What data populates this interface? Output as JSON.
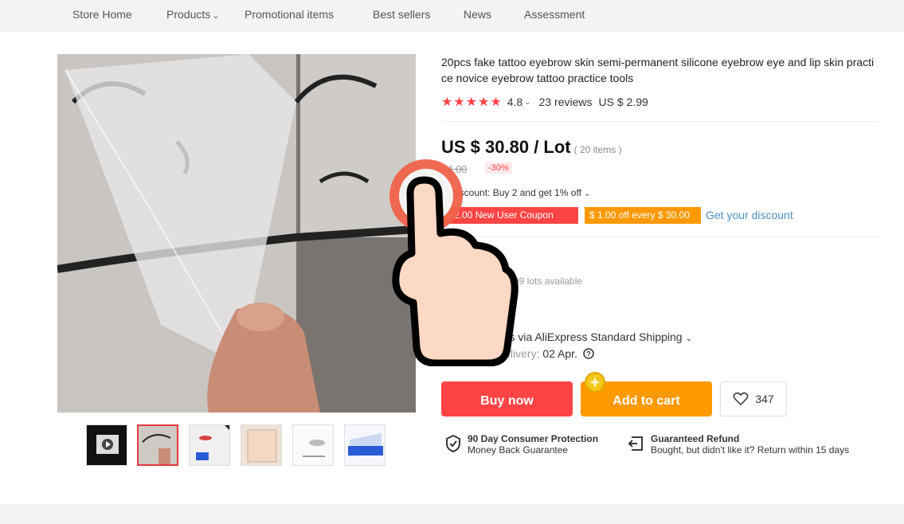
{
  "nav": {
    "items": [
      "Store Home",
      "Products",
      "Promotional items",
      "Best sellers",
      "News",
      "Assessment"
    ]
  },
  "product": {
    "title": "20pcs fake tattoo eyebrow skin semi-permanent silicone eyebrow eye and lip skin practice novice eyebrow tattoo practice tools",
    "rating": "4.8",
    "reviews": "23 reviews",
    "ref_price": "US $ 2.99",
    "price": "US $ 30.80 / Lot",
    "unit_note": "( 20 items )",
    "original_price": "44.00",
    "discount_badge": "-30%",
    "store_discount": "nt discount: Buy 2 and get 1% off",
    "coupon_red": "$ 2.00 New User Coupon",
    "coupon_orange": "$ 1.00 off every $ 30.00",
    "get_discount": "Get your discount",
    "availability": "99 lots available",
    "shipping_title": "g",
    "shipping_line": "ates via AliExpress Standard Shipping",
    "delivery_label": "Delivery:",
    "delivery_date": "02 Apr.",
    "buy_now": "Buy now",
    "add_to_cart": "Add to cart",
    "wishlist_count": "347",
    "guarantee1_title": "90 Day Consumer Protection",
    "guarantee1_sub": "Money Back Guarantee",
    "guarantee2_title": "Guaranteed Refund",
    "guarantee2_sub": "Bought, but didn't like it? Return within 15 days"
  },
  "colors": {
    "accent_red": "#ff4747",
    "accent_orange": "#ff9900",
    "link_blue": "#4a90c2"
  },
  "icons": [
    "chevron-down-icon",
    "star-icon",
    "help-icon",
    "heart-icon",
    "shield-icon",
    "refund-icon",
    "hand-pointer-icon",
    "coin-icon"
  ]
}
